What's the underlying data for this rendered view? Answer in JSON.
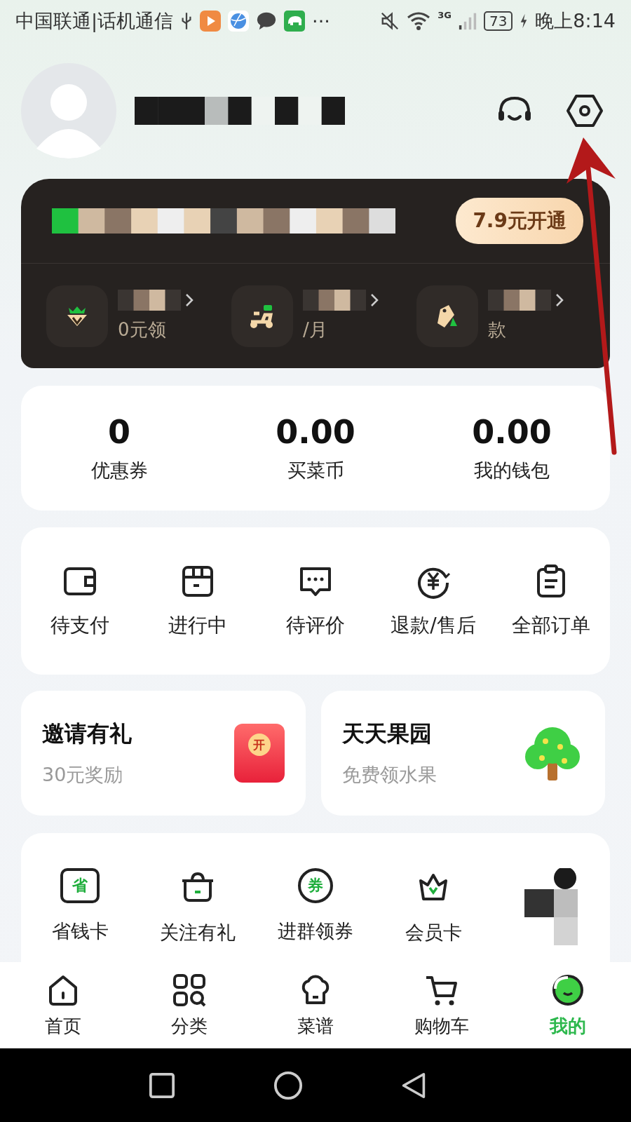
{
  "status_bar": {
    "carrier": "中国联通|话机通信",
    "more": "···",
    "network": "3G",
    "battery": "73",
    "time": "晚上8:14"
  },
  "member_card": {
    "action": "7.9元开通",
    "perks": [
      {
        "subtitle": "0元领"
      },
      {
        "subtitle": "/月"
      },
      {
        "subtitle": "款"
      }
    ]
  },
  "stats": [
    {
      "value": "0",
      "label": "优惠券"
    },
    {
      "value": "0.00",
      "label": "买菜币"
    },
    {
      "value": "0.00",
      "label": "我的钱包"
    }
  ],
  "orders": [
    {
      "label": "待支付"
    },
    {
      "label": "进行中"
    },
    {
      "label": "待评价"
    },
    {
      "label": "退款/售后"
    },
    {
      "label": "全部订单"
    }
  ],
  "promos": [
    {
      "title": "邀请有礼",
      "subtitle": "30元奖励",
      "badge": "开"
    },
    {
      "title": "天天果园",
      "subtitle": "免费领水果"
    }
  ],
  "services": [
    {
      "label": "省钱卡",
      "icon_text": "省"
    },
    {
      "label": "关注有礼"
    },
    {
      "label": "进群领券",
      "icon_text": "券"
    },
    {
      "label": "会员卡"
    }
  ],
  "tab_bar": [
    {
      "label": "首页",
      "selected": false
    },
    {
      "label": "分类",
      "selected": false
    },
    {
      "label": "菜谱",
      "selected": false
    },
    {
      "label": "购物车",
      "selected": false
    },
    {
      "label": "我的",
      "selected": true
    }
  ]
}
